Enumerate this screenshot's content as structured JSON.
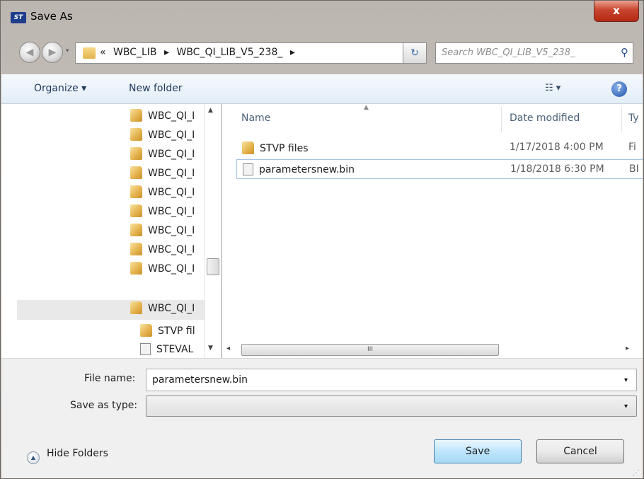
{
  "window": {
    "title": "Save As",
    "close_label": "x",
    "app_icon_text": "ST"
  },
  "address": {
    "back_icon": "back-arrow-icon",
    "forward_icon": "forward-arrow-icon",
    "overflow": "«",
    "crumbs": [
      "WBC_LIB",
      "▸",
      "WBC_QI_LIB_V5_238_",
      "▸"
    ],
    "dropdown": "▾",
    "refresh": "↻"
  },
  "search": {
    "placeholder": "Search WBC_QI_LIB_V5_238_",
    "icon": "⚲"
  },
  "toolbar": {
    "organize": "Organize ▾",
    "new_folder": "New folder",
    "views": "☷ ▾",
    "help": "?"
  },
  "tree": {
    "items": [
      {
        "label": "WBC_QI_I"
      },
      {
        "label": "WBC_QI_I"
      },
      {
        "label": "WBC_QI_I"
      },
      {
        "label": "WBC_QI_I"
      },
      {
        "label": "WBC_QI_I"
      },
      {
        "label": "WBC_QI_I"
      },
      {
        "label": "WBC_QI_I"
      },
      {
        "label": "WBC_QI_I"
      },
      {
        "label": "WBC_QI_I"
      },
      {
        "label": "WBC_QI_I"
      },
      {
        "label": "STVP fil"
      },
      {
        "label": "STEVAL"
      }
    ],
    "scroll_up": "▲",
    "scroll_down": "▼"
  },
  "files": {
    "columns": {
      "name": "Name",
      "date": "Date modified",
      "type": "Ty"
    },
    "sort_indicator": "▲",
    "rows": [
      {
        "name": "STVP files",
        "date": "1/17/2018 4:00 PM",
        "type": "Fi"
      },
      {
        "name": "parametersnew.bin",
        "date": "1/18/2018 6:30 PM",
        "type": "BI"
      }
    ],
    "hscroll_left": "◂",
    "hscroll_grip": "III",
    "hscroll_right": "▸"
  },
  "form": {
    "filename_label": "File name:",
    "filename_value": "parametersnew.bin",
    "savetype_label": "Save as type:",
    "savetype_value": "",
    "arrow": "▾"
  },
  "footer": {
    "hide_folders": "Hide Folders",
    "hide_icon": "▲",
    "save": "Save",
    "cancel": "Cancel",
    "grip": "⋰"
  }
}
